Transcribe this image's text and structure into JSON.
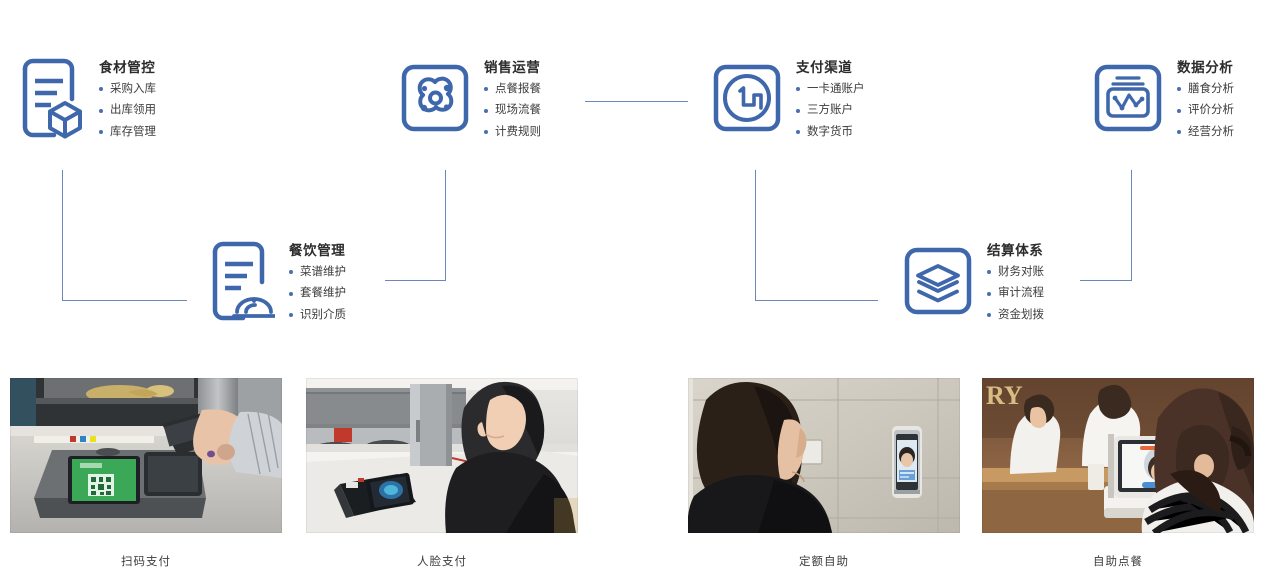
{
  "theme": {
    "icon_blue": "#3f67ab",
    "connector_blue": "#6a87bd",
    "bullet_blue": "#4a6fae",
    "title_color": "#2b2b2b",
    "body_color": "#3c3c3c",
    "background": "#ffffff"
  },
  "diagram": {
    "modules": [
      {
        "id": "ingredient-control",
        "title": "食材管控",
        "icon": "document-box-icon",
        "items": [
          "采购入库",
          "出库领用",
          "库存管理"
        ]
      },
      {
        "id": "sales-operation",
        "title": "销售运营",
        "icon": "atom-icon",
        "items": [
          "点餐报餐",
          "现场流餐",
          "计费规则"
        ]
      },
      {
        "id": "payment-channel",
        "title": "支付渠道",
        "icon": "currency-circle-icon",
        "items": [
          "一卡通账户",
          "三方账户",
          "数字货币"
        ]
      },
      {
        "id": "data-analysis",
        "title": "数据分析",
        "icon": "chart-window-icon",
        "items": [
          "膳食分析",
          "评价分析",
          "经营分析"
        ]
      },
      {
        "id": "catering-management",
        "title": "餐饮管理",
        "icon": "document-dish-icon",
        "items": [
          "菜谱维护",
          "套餐维护",
          "识别介质"
        ]
      },
      {
        "id": "settlement-system",
        "title": "结算体系",
        "icon": "layers-icon",
        "items": [
          "财务对账",
          "审计流程",
          "资金划拨"
        ]
      }
    ]
  },
  "gallery": {
    "photos": [
      {
        "id": "scan-pay",
        "caption": "扫码支付",
        "alt": "手机在POS终端上扫码支付"
      },
      {
        "id": "face-pay",
        "caption": "人脸支付",
        "alt": "顾客在取餐台前使用人脸支付终端"
      },
      {
        "id": "fixed-amount-self-service",
        "caption": "定额自助",
        "alt": "顾客站在墙面人脸识别终端前"
      },
      {
        "id": "self-order",
        "caption": "自助点餐",
        "alt": "顾客在柜台自助点餐机前点餐"
      }
    ]
  }
}
